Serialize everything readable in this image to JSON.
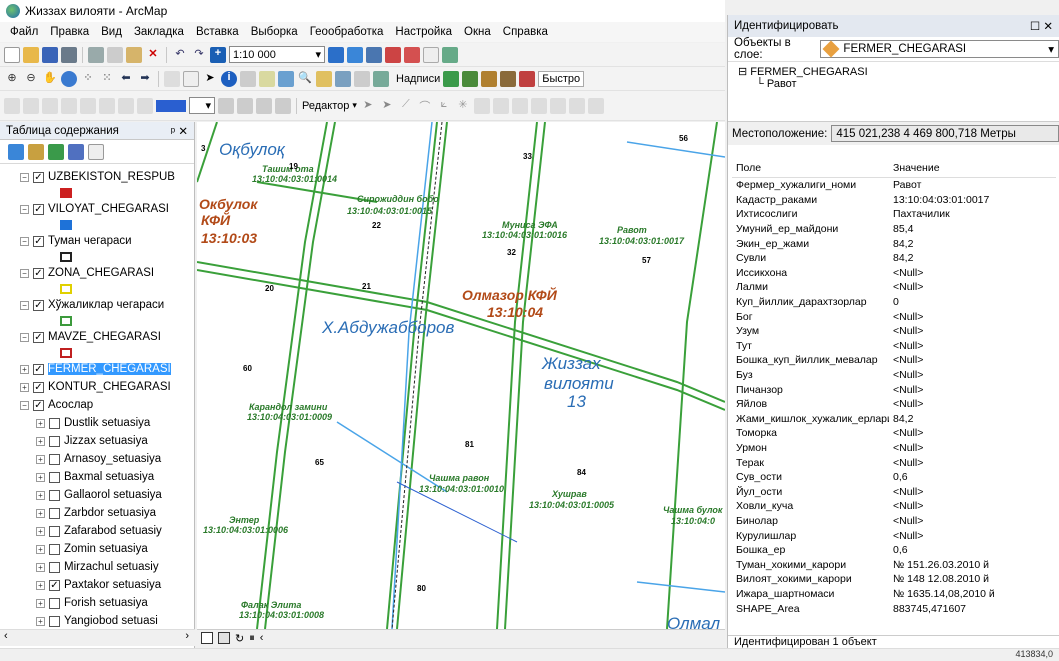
{
  "window": {
    "title": "Жиззах вилояти - ArcMap"
  },
  "menu": [
    "Файл",
    "Правка",
    "Вид",
    "Закладка",
    "Вставка",
    "Выборка",
    "Геообработка",
    "Настройка",
    "Окна",
    "Справка"
  ],
  "toolbar": {
    "scale": "1:10 000",
    "labels_menu": "Надписи",
    "fast": "Быстро",
    "editor": "Редактор"
  },
  "toc": {
    "title": "Таблица содержания",
    "layers": [
      {
        "name": "UZBEKISTON_RESPUB",
        "checked": true,
        "sym": "#cc2020"
      },
      {
        "name": "VILOYAT_CHEGARASI",
        "checked": true,
        "sym": "#1e72d8"
      },
      {
        "name": "Туман чегараси",
        "checked": true,
        "sym": "#222"
      },
      {
        "name": "ZONA_CHEGARASI",
        "checked": true,
        "sym": "#e0d000"
      },
      {
        "name": "Хўжаликлар чегараси",
        "checked": true,
        "sym": "#3c9a3c"
      },
      {
        "name": "MAVZE_CHEGARASI",
        "checked": true,
        "sym": "#c02020"
      },
      {
        "name": "FERMER_CHEGARASI",
        "checked": true,
        "selected": true
      },
      {
        "name": "KONTUR_CHEGARASI",
        "checked": true
      },
      {
        "name": "Асослар",
        "checked": true
      }
    ],
    "sublayers": [
      {
        "name": "Dustlik setuasiya",
        "checked": false
      },
      {
        "name": "Jizzax setuasiya",
        "checked": false
      },
      {
        "name": "Arnasoy_setuasiya",
        "checked": false
      },
      {
        "name": "Baxmal setuasiya",
        "checked": false
      },
      {
        "name": "Gallaorol setuasiya",
        "checked": false
      },
      {
        "name": "Zarbdor setuasiya",
        "checked": false
      },
      {
        "name": "Zafarabod setuasiy",
        "checked": false
      },
      {
        "name": "Zomin setuasiya",
        "checked": false
      },
      {
        "name": "Mirzachul setuasiy",
        "checked": false
      },
      {
        "name": "Paxtakor setuasiya",
        "checked": true
      },
      {
        "name": "Forish setuasiya",
        "checked": false
      },
      {
        "name": "Yangiobod setuasi",
        "checked": false
      }
    ]
  },
  "identify": {
    "title": "Идентифицировать",
    "layer_label": "Объекты в слое:",
    "layer_value": "FERMER_CHEGARASI",
    "tree_root": "FERMER_CHEGARASI",
    "tree_child": "Равот",
    "location_label": "Местоположение:",
    "location_value": "415 021,238  4 469 800,718 Метры",
    "col_field": "Поле",
    "col_value": "Значение",
    "rows": [
      [
        "Фермер_хужалиги_номи",
        "Равот"
      ],
      [
        "Кадастр_раками",
        "13:10:04:03:01:0017"
      ],
      [
        "Ихтисослиги",
        "Пахтачилик"
      ],
      [
        "Умуний_ер_майдони",
        "85,4"
      ],
      [
        "Экин_ер_жами",
        "84,2"
      ],
      [
        "Сувли",
        "84,2"
      ],
      [
        "Иссикхона",
        "<Null>"
      ],
      [
        "Лалми",
        "<Null>"
      ],
      [
        "Куп_йиллик_дарахтзорлар",
        "0"
      ],
      [
        "Бог",
        "<Null>"
      ],
      [
        "Узум",
        "<Null>"
      ],
      [
        "Тут",
        "<Null>"
      ],
      [
        "Бошка_куп_йиллик_мевалар",
        "<Null>"
      ],
      [
        "Буз",
        "<Null>"
      ],
      [
        "Пичанзор",
        "<Null>"
      ],
      [
        "Яйлов",
        "<Null>"
      ],
      [
        "Жами_кишлок_хужалик_ерлари",
        "84,2"
      ],
      [
        "Томорка",
        "<Null>"
      ],
      [
        "Урмон",
        "<Null>"
      ],
      [
        "Терак",
        "<Null>"
      ],
      [
        "Сув_ости",
        "0,6"
      ],
      [
        "Йул_ости",
        "<Null>"
      ],
      [
        "Ховли_куча",
        "<Null>"
      ],
      [
        "Бинолар",
        "<Null>"
      ],
      [
        "Курулишлар",
        "<Null>"
      ],
      [
        "Бошка_ер",
        "0,6"
      ],
      [
        "Туман_хокими_карори",
        "№ 151.26.03.2010 й"
      ],
      [
        "Вилоят_хокими_карори",
        "№ 148 12.08.2010 й"
      ],
      [
        "Ижара_шартномаси",
        "№ 1635.14,08,2010 й"
      ],
      [
        "SHAPE_Area",
        "883745,471607"
      ]
    ],
    "footer": "Идентифицирован 1 объект"
  },
  "map": {
    "labels": [
      {
        "t": "Оқбулоқ",
        "c": "big"
      },
      {
        "t": "Ташим ота",
        "c": "g"
      },
      {
        "t": "13:10:04:03:01:0014",
        "c": "g"
      },
      {
        "t": "Окбулок",
        "c": "red"
      },
      {
        "t": "КФЙ",
        "c": "red"
      },
      {
        "t": "13:10:03",
        "c": "red"
      },
      {
        "t": "Сирожиддин бобо",
        "c": "g"
      },
      {
        "t": "13:10:04:03:01:0015",
        "c": "g"
      },
      {
        "t": "Мунисa ЭФА",
        "c": "g"
      },
      {
        "t": "13:10:04:03:01:0016",
        "c": "g"
      },
      {
        "t": "Равот",
        "c": "g"
      },
      {
        "t": "13:10:04:03:01:0017",
        "c": "g"
      },
      {
        "t": "Олмазор КФЙ",
        "c": "red"
      },
      {
        "t": "13:10:04",
        "c": "red"
      },
      {
        "t": "Х.Абдужабборов",
        "c": "big"
      },
      {
        "t": "Жиззах",
        "c": "big"
      },
      {
        "t": "вилояти",
        "c": "big"
      },
      {
        "t": "13",
        "c": "big"
      },
      {
        "t": "Карандол замини",
        "c": "g"
      },
      {
        "t": "13:10:04:03:01:0009",
        "c": "g"
      },
      {
        "t": "Чашма равон",
        "c": "g"
      },
      {
        "t": "13:10:04:03:01:0010",
        "c": "g"
      },
      {
        "t": "Хушрав",
        "c": "g"
      },
      {
        "t": "13:10:04:03:01:0005",
        "c": "g"
      },
      {
        "t": "Чашма булок",
        "c": "g"
      },
      {
        "t": "13:10:04:0",
        "c": "g"
      },
      {
        "t": "Энтер",
        "c": "g"
      },
      {
        "t": "13:10:04:03:01:0006",
        "c": "g"
      },
      {
        "t": "Фалак Элита",
        "c": "g"
      },
      {
        "t": "13:10:04:03:01:0008",
        "c": "g"
      },
      {
        "t": "Олмал",
        "c": "big"
      }
    ],
    "numbers": [
      "56",
      "19",
      "33",
      "22",
      "32",
      "57",
      "60",
      "81",
      "65",
      "84",
      "80",
      "3",
      "21",
      "20"
    ]
  },
  "status": {
    "coords": "413834,0"
  }
}
